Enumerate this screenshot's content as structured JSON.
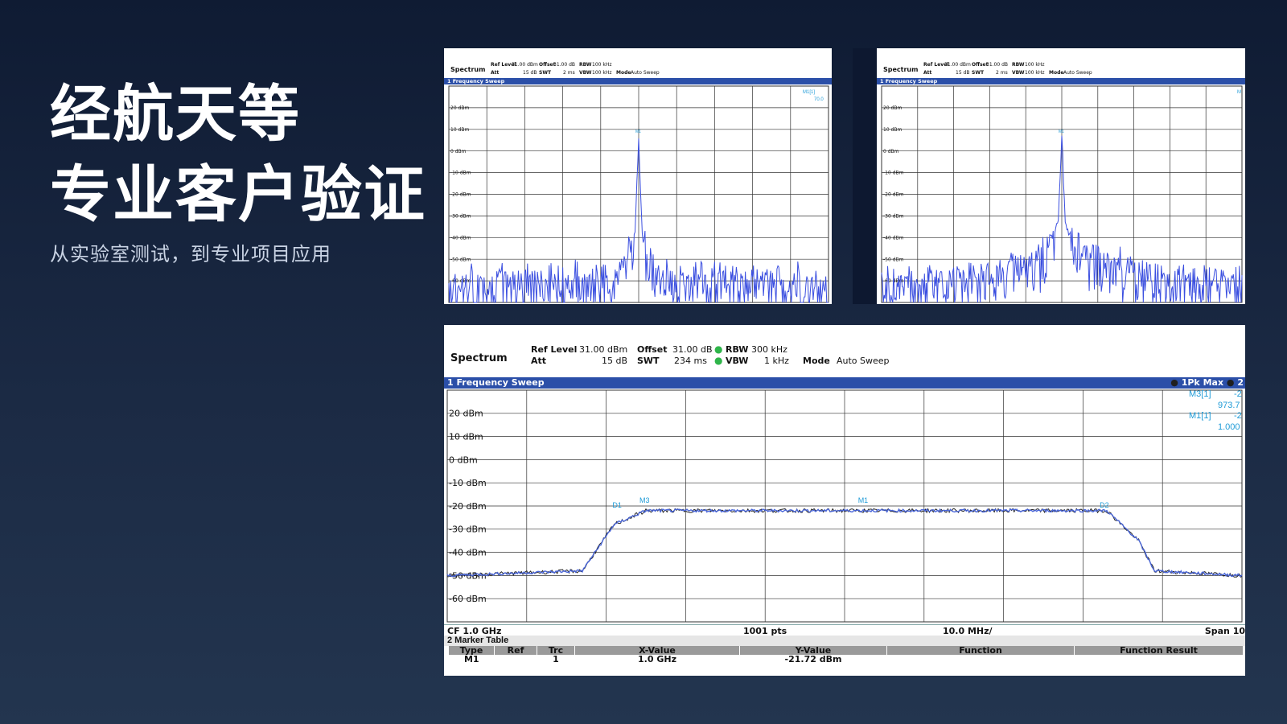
{
  "headline": {
    "line1": "经航天等",
    "line2": "专业客户验证"
  },
  "subline": "从实验室测试，到专业项目应用",
  "small_panels": [
    {
      "app": "Spectrum",
      "ref_level_label": "Ref Level",
      "ref_level": "31.00 dBm",
      "offset_label": "Offset",
      "offset": "31.00 dB",
      "rbw_label": "RBW",
      "rbw": "100 kHz",
      "att_label": "Att",
      "att": "15 dB",
      "swt_label": "SWT",
      "swt": "2 ms",
      "vbw_label": "VBW",
      "vbw": "100 kHz",
      "mode_label": "Mode",
      "mode": "Auto Sweep",
      "sweep_title": "1 Frequency Sweep",
      "marker_readout": "M1[1]",
      "marker_value": "70.0",
      "marker_label": "M1",
      "y_labels": [
        "20 dBm",
        "10 dBm",
        "0 dBm",
        "-10 dBm",
        "-20 dBm",
        "-30 dBm",
        "-40 dBm",
        "-50 dBm",
        "-60 dBm"
      ]
    },
    {
      "app": "Spectrum",
      "ref_level_label": "Ref Level",
      "ref_level": "31.00 dBm",
      "offset_label": "Offset",
      "offset": "31.00 dB",
      "rbw_label": "RBW",
      "rbw": "100 kHz",
      "att_label": "Att",
      "att": "15 dB",
      "swt_label": "SWT",
      "swt": "2 ms",
      "vbw_label": "VBW",
      "vbw": "100 kHz",
      "mode_label": "Mode",
      "mode": "Auto Sweep",
      "sweep_title": "1 Frequency Sweep",
      "marker_readout": "M",
      "marker_value": "",
      "marker_label": "M1",
      "y_labels": [
        "20 dBm",
        "10 dBm",
        "0 dBm",
        "-10 dBm",
        "-20 dBm",
        "-30 dBm",
        "-40 dBm",
        "-50 dBm",
        "-60 dBm"
      ]
    }
  ],
  "big_panel": {
    "app": "Spectrum",
    "ref_level_label": "Ref Level",
    "ref_level": "31.00 dBm",
    "offset_label": "Offset",
    "offset": "31.00 dB",
    "rbw_label": "RBW",
    "rbw": "300 kHz",
    "att_label": "Att",
    "att": "15 dB",
    "swt_label": "SWT",
    "swt": "234 ms",
    "vbw_label": "VBW",
    "vbw": "1 kHz",
    "mode_label": "Mode",
    "mode": "Auto Sweep",
    "sweep_title": "1 Frequency Sweep",
    "trace_label": "1Pk Max",
    "trace_extra": "2",
    "readouts": [
      {
        "label": "M3[1]",
        "value": "-2",
        "value2": "973.7"
      },
      {
        "label": "M1[1]",
        "value": "-2",
        "value2": "1.000"
      }
    ],
    "y_labels": [
      "20 dBm",
      "10 dBm",
      "0 dBm",
      "-10 dBm",
      "-20 dBm",
      "-30 dBm",
      "-40 dBm",
      "-50 dBm",
      "-60 dBm"
    ],
    "markers": {
      "m1": "M1",
      "m3": "M3",
      "d1": "D1",
      "d2": "D2"
    },
    "footer": {
      "cf": "CF 1.0 GHz",
      "pts": "1001 pts",
      "div": "10.0 MHz/",
      "span": "Span 10"
    },
    "marker_table_title": "2 Marker Table",
    "marker_table_headers": [
      "Type",
      "Ref",
      "Trc",
      "X-Value",
      "Y-Value",
      "Function",
      "Function Result"
    ],
    "marker_table_rows": [
      [
        "M1",
        "",
        "1",
        "1.0 GHz",
        "-21.72 dBm",
        "",
        ""
      ]
    ]
  },
  "colors": {
    "trace": "#3b4fe0",
    "marker": "#1f9bd7",
    "sweep_bar": "#2b4fa8"
  },
  "chart_data": [
    {
      "type": "line",
      "xlabel": "",
      "ylabel": "",
      "ylim": [
        -70,
        30
      ],
      "x": [
        0,
        0.45,
        0.49,
        0.5,
        0.51,
        0.55,
        1
      ],
      "series": [
        {
          "values": [
            -62,
            -60,
            -40,
            7,
            -40,
            -60,
            -62
          ]
        }
      ]
    },
    {
      "type": "line",
      "xlabel": "",
      "ylabel": "",
      "ylim": [
        -70,
        30
      ],
      "x": [
        0,
        0.3,
        0.45,
        0.49,
        0.5,
        0.51,
        0.55,
        0.75,
        1
      ],
      "series": [
        {
          "values": [
            -62,
            -60,
            -48,
            -35,
            7,
            -35,
            -48,
            -60,
            -62
          ]
        }
      ]
    },
    {
      "type": "line",
      "xlabel": "",
      "ylabel": "",
      "ylim": [
        -70,
        30
      ],
      "x": [
        0,
        0.17,
        0.21,
        0.25,
        0.5,
        0.83,
        0.87,
        0.89,
        1
      ],
      "series": [
        {
          "values": [
            -50,
            -48,
            -28,
            -22,
            -22,
            -22,
            -35,
            -48,
            -50
          ]
        }
      ]
    }
  ]
}
